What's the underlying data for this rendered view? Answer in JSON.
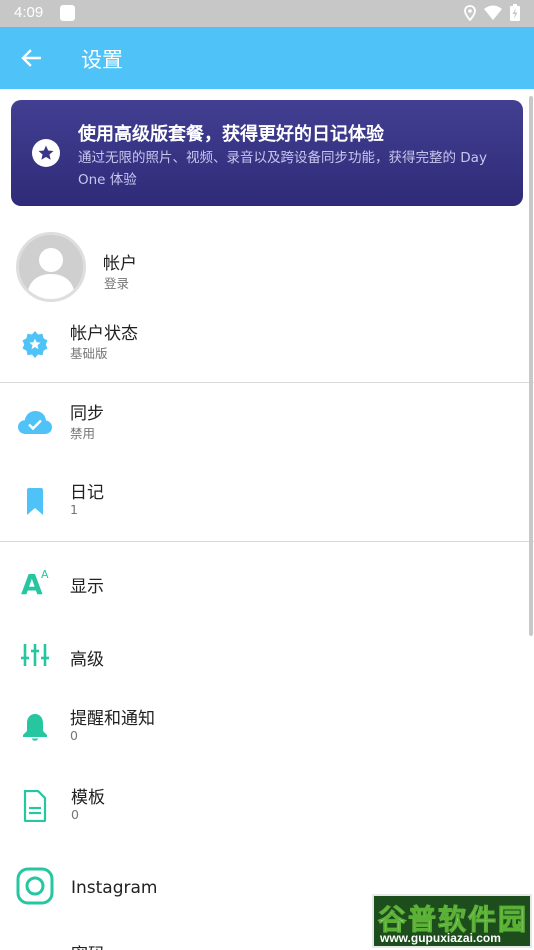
{
  "status_bar": {
    "time": "4:09"
  },
  "app_bar": {
    "title": "设置"
  },
  "promo": {
    "title": "使用高级版套餐，获得更好的日记体验",
    "description": "通过无限的照片、视频、录音以及跨设备同步功能，获得完整的 Day One 体验"
  },
  "account": {
    "title": "帐户",
    "subtitle": "登录"
  },
  "account_status": {
    "title": "帐户状态",
    "subtitle": "基础版"
  },
  "sync": {
    "title": "同步",
    "subtitle": "禁用"
  },
  "journals": {
    "title": "日记",
    "subtitle": "1"
  },
  "display": {
    "title": "显示"
  },
  "advanced": {
    "title": "高级"
  },
  "reminders": {
    "title": "提醒和通知",
    "subtitle": "0"
  },
  "templates": {
    "title": "模板",
    "subtitle": "0"
  },
  "instagram": {
    "title": "Instagram"
  },
  "next_item": {
    "title": "密码"
  },
  "watermark": {
    "brand": "谷普软件园",
    "url": "www.gupuxiazai.com"
  },
  "colors": {
    "app_bar": "#4fc3f7",
    "promo": "#3a3687",
    "blue_icon": "#4fc3f7",
    "green_icon": "#26c6a0"
  }
}
